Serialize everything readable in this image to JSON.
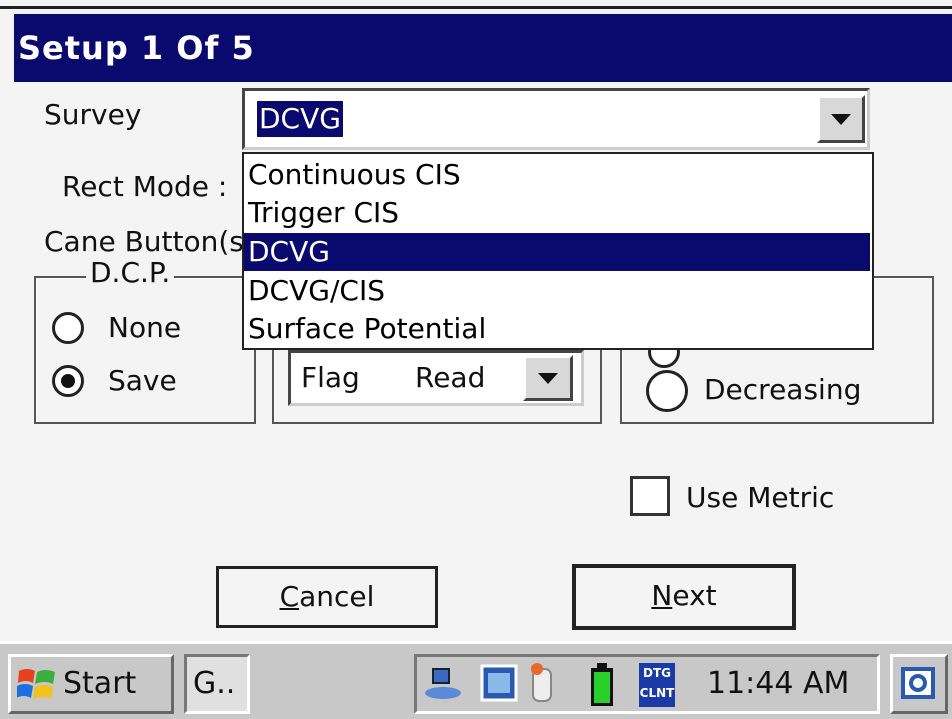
{
  "window": {
    "title": "Setup 1 Of 5"
  },
  "survey": {
    "label": "Survey",
    "value": "DCVG"
  },
  "rect_mode": {
    "label": "Rect Mode :"
  },
  "cane_button": {
    "label": "Cane Button(s"
  },
  "dcp": {
    "legend": "D.C.P.",
    "options": [
      "None",
      "Save"
    ],
    "selected": "Save"
  },
  "cane_select": {
    "left": "Flag",
    "right": "Read"
  },
  "direction": {
    "option_visible": "Decreasing"
  },
  "use_metric": {
    "label": "Use Metric",
    "checked": false
  },
  "buttons": {
    "cancel_prefix": "",
    "cancel_ul": "C",
    "cancel_rest": "ancel",
    "next_ul": "N",
    "next_rest": "ext"
  },
  "dropdown": {
    "items": [
      "Continuous CIS",
      "Trigger CIS",
      "DCVG",
      "DCVG/CIS",
      "Surface Potential"
    ],
    "selected": "DCVG"
  },
  "taskbar": {
    "start_label": "Start",
    "task_label": "G..",
    "clock": "11:44 AM",
    "tray_badge": "DTG CLNT"
  },
  "colors": {
    "title_bg": "#0a0a6e",
    "selection": "#0a0a6e",
    "taskbar": "#c8c8c8"
  }
}
